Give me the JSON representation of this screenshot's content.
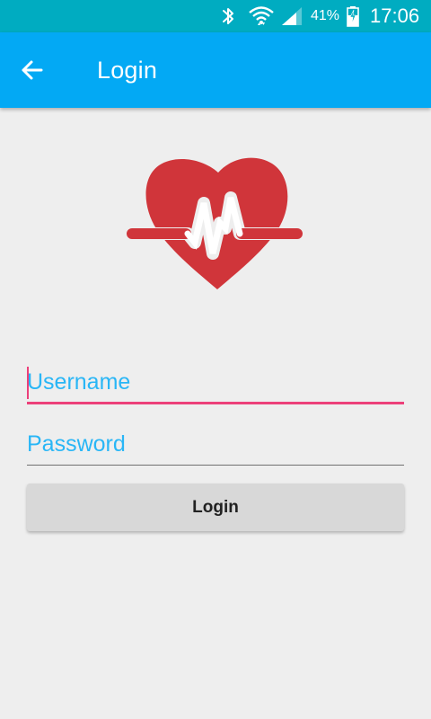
{
  "status_bar": {
    "battery_percent": "41%",
    "time": "17:06",
    "icons": [
      "bluetooth-icon",
      "wifi-icon",
      "cell-signal-icon",
      "battery-charging-icon"
    ]
  },
  "app_bar": {
    "title": "Login",
    "back_icon": "arrow-back-icon"
  },
  "logo": {
    "icon": "heart-pulse-icon",
    "color": "#d0353a"
  },
  "form": {
    "username_placeholder": "Username",
    "password_placeholder": "Password",
    "login_label": "Login"
  },
  "colors": {
    "status_bar": "#00acc1",
    "app_bar": "#03a9f4",
    "accent": "#ec407a",
    "hint": "#29b6f6",
    "background": "#eeeeee",
    "button": "#d8d8d8"
  }
}
